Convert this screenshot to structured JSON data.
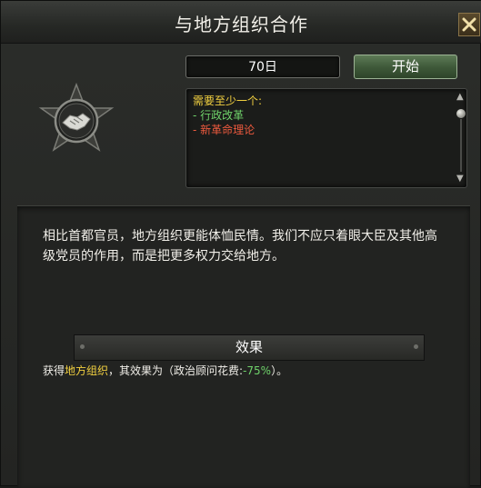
{
  "window": {
    "title": "与地方组织合作"
  },
  "action": {
    "duration": "70日",
    "start_label": "开始"
  },
  "requirements": {
    "heading": "需要至少一个:",
    "items": [
      {
        "text": "- 行政改革",
        "color": "#6fd26a"
      },
      {
        "text": "- 新革命理论",
        "color": "#ee5a3e"
      }
    ]
  },
  "description": {
    "text": "相比首都官员，地方组织更能体恤民情。我们不应只着眼大臣及其他高级党员的作用，而是把更多权力交给地方。"
  },
  "effects": {
    "header": "效果",
    "line": {
      "prefix": "获得",
      "idea": "地方组织",
      "middle": "，其效果为（政治顾问花费:",
      "value": "-75%",
      "suffix": "）。"
    }
  },
  "icons": {
    "emblem": "handshake-emblem-icon",
    "close": "close-icon"
  },
  "colors": {
    "accent_green": "#6fd26a",
    "accent_red": "#ee5a3e",
    "accent_yellow": "#f2d040"
  }
}
